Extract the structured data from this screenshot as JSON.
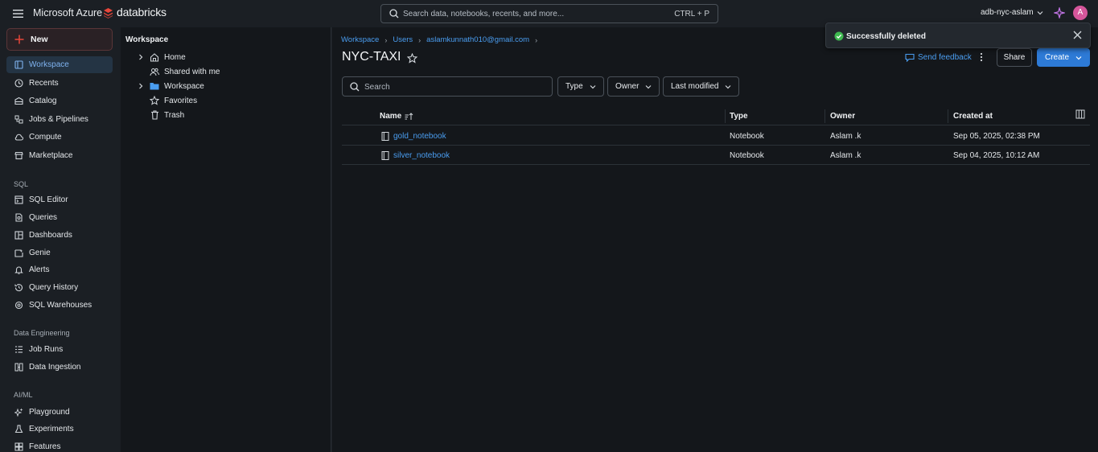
{
  "topbar": {
    "brand_azure": "Microsoft Azure",
    "brand_databricks": "databricks",
    "search_placeholder": "Search data, notebooks, recents, and more...",
    "search_shortcut": "CTRL + P",
    "workspace_name": "adb-nyc-aslam",
    "avatar_initial": "A"
  },
  "leftnav": {
    "new_label": "New",
    "items": [
      {
        "label": "Workspace",
        "icon": "workspace-icon",
        "active": true
      },
      {
        "label": "Recents",
        "icon": "clock-icon"
      },
      {
        "label": "Catalog",
        "icon": "catalog-icon"
      },
      {
        "label": "Jobs & Pipelines",
        "icon": "jobs-icon"
      },
      {
        "label": "Compute",
        "icon": "cloud-icon"
      },
      {
        "label": "Marketplace",
        "icon": "store-icon"
      }
    ],
    "sql_section": "SQL",
    "sql_items": [
      {
        "label": "SQL Editor",
        "icon": "editor-icon"
      },
      {
        "label": "Queries",
        "icon": "queries-icon"
      },
      {
        "label": "Dashboards",
        "icon": "dashboard-icon"
      },
      {
        "label": "Genie",
        "icon": "genie-icon"
      },
      {
        "label": "Alerts",
        "icon": "bell-icon"
      },
      {
        "label": "Query History",
        "icon": "history-icon"
      },
      {
        "label": "SQL Warehouses",
        "icon": "warehouse-icon"
      }
    ],
    "de_section": "Data Engineering",
    "de_items": [
      {
        "label": "Job Runs",
        "icon": "list-icon"
      },
      {
        "label": "Data Ingestion",
        "icon": "ingestion-icon"
      }
    ],
    "aiml_section": "AI/ML",
    "aiml_items": [
      {
        "label": "Playground",
        "icon": "sparkle-icon"
      },
      {
        "label": "Experiments",
        "icon": "flask-icon"
      },
      {
        "label": "Features",
        "icon": "features-icon"
      }
    ]
  },
  "tree": {
    "title": "Workspace",
    "items": [
      {
        "label": "Home",
        "icon": "home-icon",
        "expandable": true
      },
      {
        "label": "Shared with me",
        "icon": "users-icon",
        "expandable": false
      },
      {
        "label": "Workspace",
        "icon": "folder-icon",
        "expandable": true
      },
      {
        "label": "Favorites",
        "icon": "star-icon",
        "expandable": false
      },
      {
        "label": "Trash",
        "icon": "trash-icon",
        "expandable": false
      }
    ]
  },
  "main": {
    "breadcrumbs": [
      "Workspace",
      "Users",
      "aslamkunnath010@gmail.com"
    ],
    "title": "NYC-TAXI",
    "send_feedback": "Send feedback",
    "share_label": "Share",
    "create_label": "Create",
    "search_placeholder": "Search",
    "filters": [
      "Type",
      "Owner",
      "Last modified"
    ],
    "columns": [
      "Name",
      "Type",
      "Owner",
      "Created at"
    ],
    "rows": [
      {
        "name": "gold_notebook",
        "type": "Notebook",
        "owner": "Aslam .k",
        "created": "Sep 05, 2025, 02:38 PM"
      },
      {
        "name": "silver_notebook",
        "type": "Notebook",
        "owner": "Aslam .k",
        "created": "Sep 04, 2025, 10:12 AM"
      }
    ]
  },
  "toast": {
    "message": "Successfully deleted"
  },
  "colors": {
    "accent": "#2d7ad6",
    "link": "#4a9df0",
    "success": "#3fb950",
    "brand_red": "#e8463a"
  }
}
